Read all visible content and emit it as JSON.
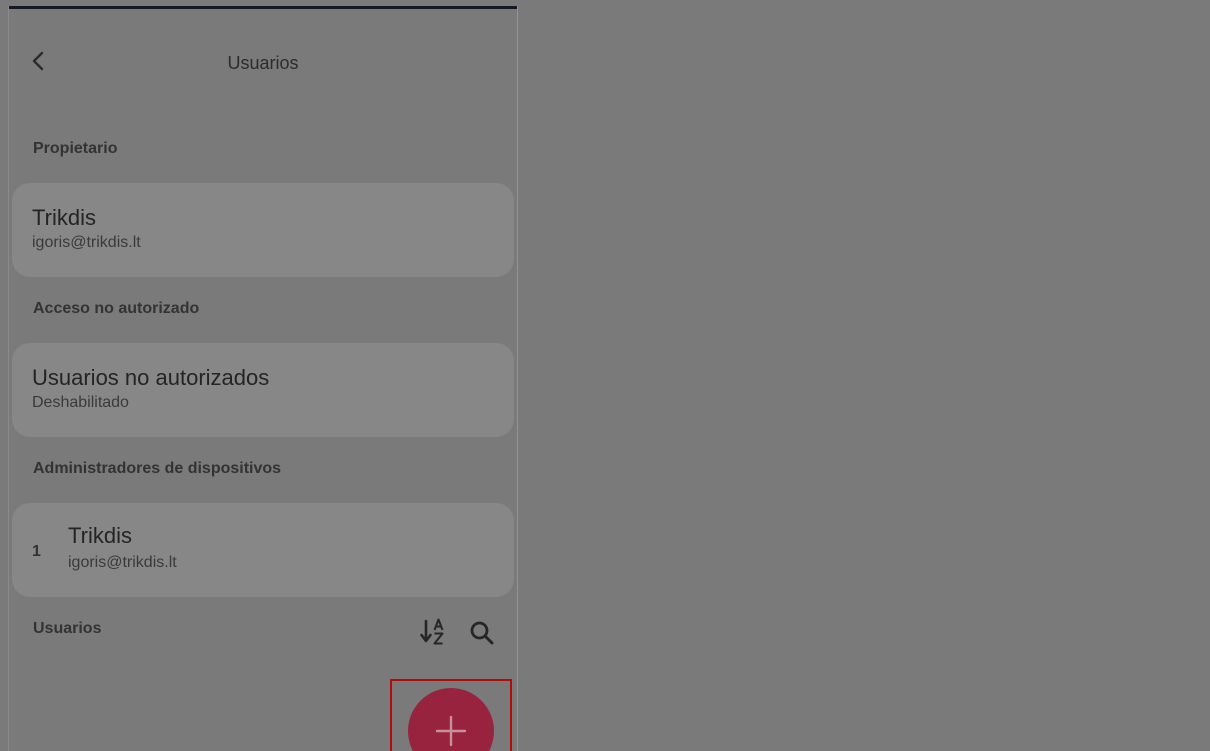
{
  "header": {
    "title": "Usuarios"
  },
  "owner": {
    "section_label": "Propietario",
    "name": "Trikdis",
    "email": "igoris@trikdis.lt"
  },
  "unauthorized": {
    "section_label": "Acceso no autorizado",
    "title": "Usuarios no autorizados",
    "status": "Deshabilitado"
  },
  "admins": {
    "section_label": "Administradores de dispositivos",
    "items": [
      {
        "index": "1",
        "name": "Trikdis",
        "email": "igoris@trikdis.lt"
      }
    ]
  },
  "users": {
    "section_label": "Usuarios"
  },
  "icons": {
    "back": "chevron-left-icon",
    "sort": "sort-alpha-icon",
    "search": "search-icon",
    "add": "plus-icon"
  },
  "colors": {
    "overlay_background": "#7a7a7a",
    "card": "#878787",
    "fab": "#97233e",
    "highlight_border": "#b00d0d"
  }
}
